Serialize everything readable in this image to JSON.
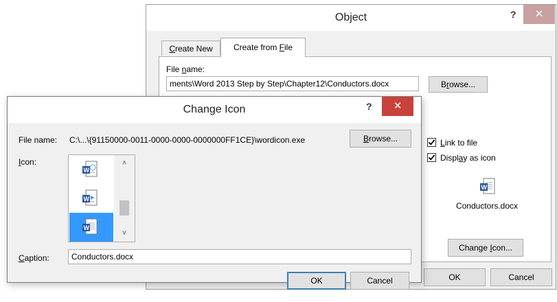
{
  "object_dialog": {
    "title": "Object",
    "help": "?",
    "close": "✕",
    "tabs": [
      {
        "pre": "",
        "key": "C",
        "post": "reate New"
      },
      {
        "pre": "Create from ",
        "key": "F",
        "post": "ile"
      }
    ],
    "file_name_label": {
      "pre": "File ",
      "key": "n",
      "post": "ame:"
    },
    "file_name_value": "ments\\Word 2013 Step by Step\\Chapter12\\Conductors.docx",
    "browse_label": {
      "pre": "B",
      "key": "r",
      "post": "owse..."
    },
    "link_to_file": {
      "pre": "",
      "key": "L",
      "post": "ink to file",
      "checked": true
    },
    "display_as_icon": {
      "pre": "Displ",
      "key": "a",
      "post": "y as icon",
      "checked": true
    },
    "icon_caption": "Conductors.docx",
    "change_icon_label": {
      "pre": "Change ",
      "key": "I",
      "post": "con..."
    },
    "ok_label": "OK",
    "cancel_label": "Cancel"
  },
  "change_icon_dialog": {
    "title": "Change Icon",
    "help": "?",
    "close": "✕",
    "file_name_label": "File name:",
    "file_name_value": "C:\\...\\{91150000-0011-0000-0000-0000000FF1CE}\\wordicon.exe",
    "browse_label": {
      "pre": "",
      "key": "B",
      "post": "rowse..."
    },
    "icon_label": {
      "pre": "",
      "key": "I",
      "post": "con:"
    },
    "icons": [
      {
        "name": "word-doc-icon"
      },
      {
        "name": "word-doc-icon"
      },
      {
        "name": "word-doc-icon",
        "selected": true
      }
    ],
    "caption_label": {
      "pre": "",
      "key": "C",
      "post": "aption:"
    },
    "caption_value": "Conductors.docx",
    "ok_label": "OK",
    "cancel_label": "Cancel"
  },
  "colors": {
    "close": "#c8423a",
    "accent": "#3399ff",
    "word_blue": "#2b579a"
  }
}
